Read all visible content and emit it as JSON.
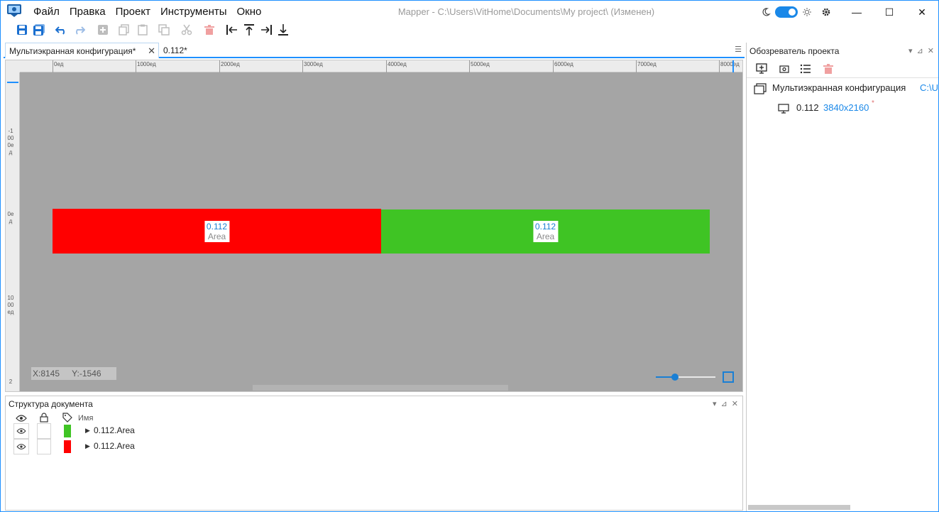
{
  "menu": [
    "Файл",
    "Правка",
    "Проект",
    "Инструменты",
    "Окно"
  ],
  "window_title": "Mapper - C:\\Users\\VitHome\\Documents\\My project\\ (Изменен)",
  "window_controls": {
    "minimize": "—",
    "maximize": "☐",
    "close": "✕"
  },
  "tabs": [
    {
      "label": "Мультиэкранная конфигурация*",
      "close": "✕"
    },
    {
      "label": "0.112*"
    }
  ],
  "ruler": {
    "top": [
      "0ед",
      "1000ед",
      "2000ед",
      "3000ед",
      "4000ед",
      "5000ед",
      "6000ед",
      "7000ед",
      "8000ед"
    ],
    "left": [
      "-1000ед",
      "0ед",
      "1000ед",
      "2"
    ]
  },
  "screens": [
    {
      "name": "0.112",
      "type": "Area",
      "color": "#ff0000"
    },
    {
      "name": "0.112",
      "type": "Area",
      "color": "#3fc424"
    }
  ],
  "coords": {
    "x": "X:8145",
    "y": "Y:-1546"
  },
  "structure": {
    "title": "Структура документа",
    "col_name": "Имя",
    "rows": [
      {
        "label": "0.112.Area",
        "color": "#3fc424"
      },
      {
        "label": "0.112.Area",
        "color": "#ff0000"
      }
    ]
  },
  "explorer": {
    "title": "Обозреватель проекта",
    "root_label": "Мультиэкранная конфигурация",
    "root_path": "C:\\U",
    "child_label": "0.112",
    "child_resolution": "3840x2160",
    "child_star": "*"
  },
  "panel_controls": {
    "menu": "▾",
    "pin": "⊿",
    "close": "✕"
  },
  "colors": {
    "accent": "#1a88e8",
    "canvas": "#a5a5a5"
  }
}
